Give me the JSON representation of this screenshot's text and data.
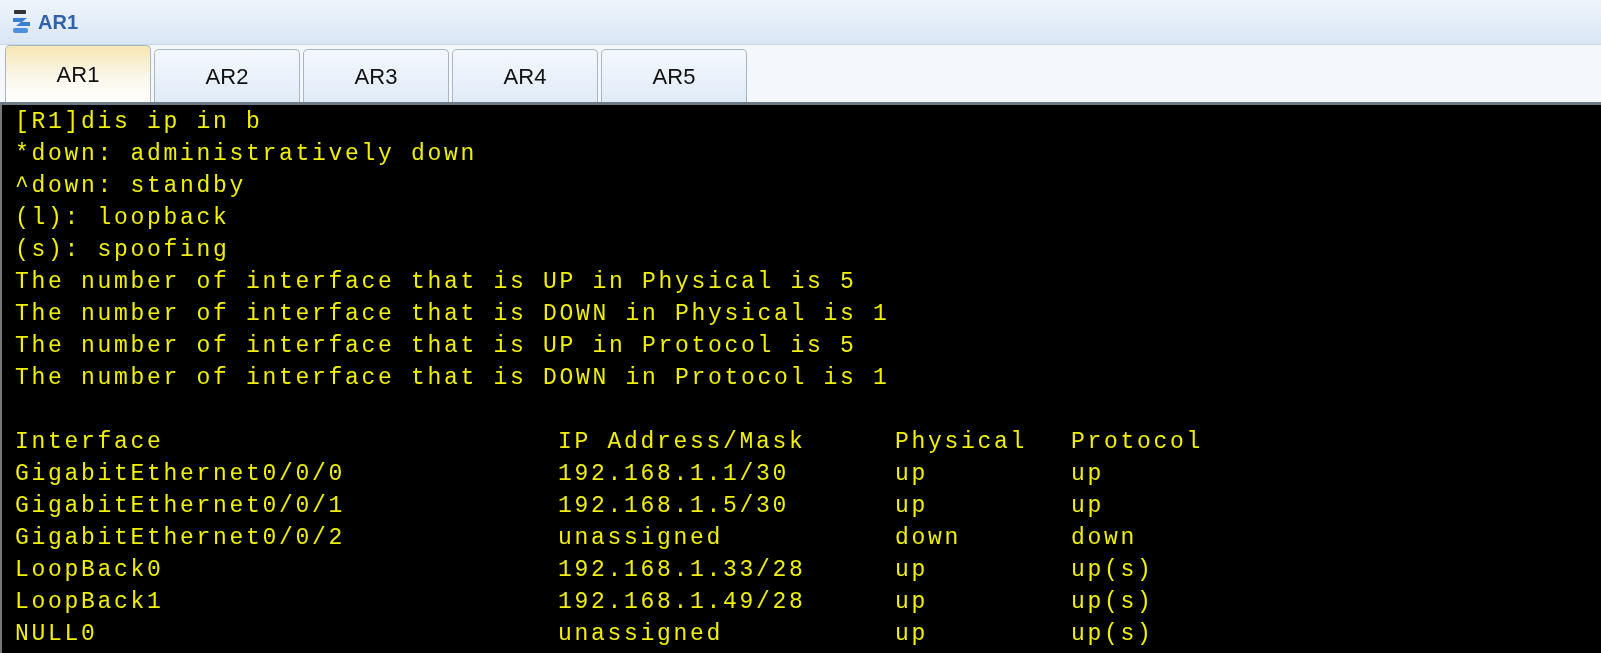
{
  "window": {
    "title": "AR1"
  },
  "tabs": [
    {
      "label": "AR1",
      "selected": true
    },
    {
      "label": "AR2",
      "selected": false
    },
    {
      "label": "AR3",
      "selected": false
    },
    {
      "label": "AR4",
      "selected": false
    },
    {
      "label": "AR5",
      "selected": false
    }
  ],
  "terminal": {
    "lines": [
      "[R1]dis ip in b",
      "*down: administratively down",
      "^down: standby",
      "(l): loopback",
      "(s): spoofing",
      "The number of interface that is UP in Physical is 5",
      "The number of interface that is DOWN in Physical is 1",
      "The number of interface that is UP in Protocol is 5",
      "The number of interface that is DOWN in Protocol is 1"
    ],
    "table": {
      "columns": [
        "Interface",
        "IP Address/Mask",
        "Physical",
        "Protocol"
      ],
      "rows": [
        [
          "GigabitEthernet0/0/0",
          "192.168.1.1/30",
          "up",
          "up"
        ],
        [
          "GigabitEthernet0/0/1",
          "192.168.1.5/30",
          "up",
          "up"
        ],
        [
          "GigabitEthernet0/0/2",
          "unassigned",
          "down",
          "down"
        ],
        [
          "LoopBack0",
          "192.168.1.33/28",
          "up",
          "up(s)"
        ],
        [
          "LoopBack1",
          "192.168.1.49/28",
          "up",
          "up(s)"
        ],
        [
          "NULL0",
          "unassigned",
          "up",
          "up(s)"
        ]
      ]
    }
  }
}
